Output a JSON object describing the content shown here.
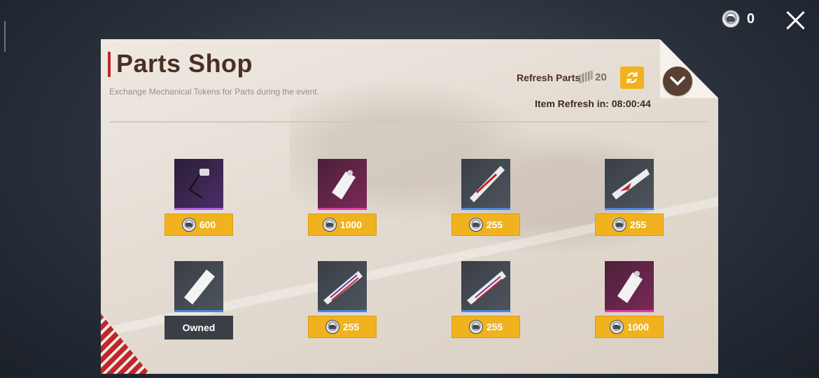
{
  "header": {
    "currency_count": "0",
    "currency_icon": "mechanical-token-icon"
  },
  "shop": {
    "title": "Parts Shop",
    "subtitle": "Exchange Mechanical Tokens for Parts during the event.",
    "refresh_label": "Refresh Parts",
    "refresh_count": "20",
    "timer_label": "Item Refresh in: 08:00:44"
  },
  "items": [
    {
      "name": "part-1",
      "price": "600",
      "rarity": "purple"
    },
    {
      "name": "part-2",
      "price": "1000",
      "rarity": "magenta"
    },
    {
      "name": "part-3",
      "price": "255",
      "rarity": "blue"
    },
    {
      "name": "part-4",
      "price": "255",
      "rarity": "blue"
    },
    {
      "name": "part-5",
      "status": "Owned",
      "rarity": "blue"
    },
    {
      "name": "part-6",
      "price": "255",
      "rarity": "blue"
    },
    {
      "name": "part-7",
      "price": "255",
      "rarity": "blue"
    },
    {
      "name": "part-8",
      "price": "1000",
      "rarity": "magenta"
    }
  ],
  "colors": {
    "accent": "#f0b21e",
    "title": "#4a2f24",
    "stripe": "#c0262b"
  }
}
